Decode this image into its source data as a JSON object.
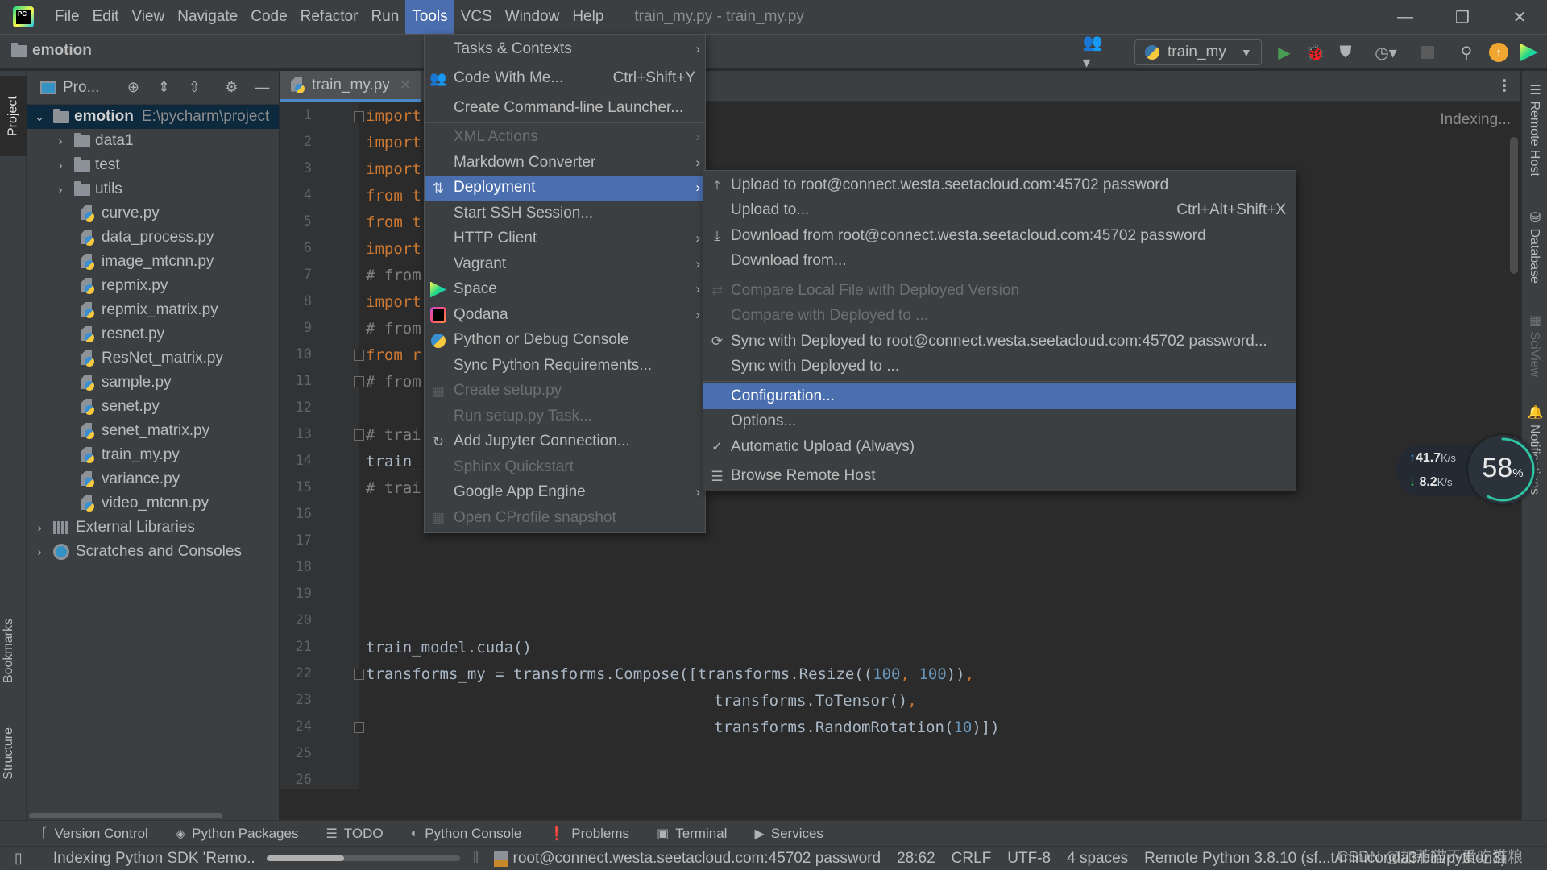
{
  "titlebar": {
    "menus": [
      "File",
      "Edit",
      "View",
      "Navigate",
      "Code",
      "Refactor",
      "Run",
      "Tools",
      "VCS",
      "Window",
      "Help"
    ],
    "active_menu": "Tools",
    "window_title": "train_my.py - train_my.py",
    "controls": {
      "minimize": "—",
      "restore": "❐",
      "close": "✕"
    }
  },
  "navbar": {
    "breadcrumb": "emotion",
    "run_config": "train_my",
    "icons": [
      "code-with-me-icon",
      "run-icon",
      "debug-icon",
      "coverage-icon",
      "profile-icon",
      "stop-icon",
      "search-icon",
      "update-icon",
      "space-icon"
    ]
  },
  "left_stripe": {
    "project": "Project",
    "bookmarks": "Bookmarks",
    "structure": "Structure"
  },
  "project_panel": {
    "title": "Pro...",
    "root": {
      "name": "emotion",
      "path": "E:\\pycharm\\project"
    },
    "folders": [
      "data1",
      "test",
      "utils"
    ],
    "files": [
      "curve.py",
      "data_process.py",
      "image_mtcnn.py",
      "repmix.py",
      "repmix_matrix.py",
      "resnet.py",
      "ResNet_matrix.py",
      "sample.py",
      "senet.py",
      "senet_matrix.py",
      "train_my.py",
      "variance.py",
      "video_mtcnn.py"
    ],
    "extras": [
      "External Libraries",
      "Scratches and Consoles"
    ]
  },
  "editor": {
    "tab": "train_my.py",
    "indexing_hint": "Indexing...",
    "line_numbers": [
      "1",
      "2",
      "3",
      "4",
      "5",
      "6",
      "7",
      "8",
      "9",
      "10",
      "11",
      "12",
      "13",
      "14",
      "15",
      "16",
      "17",
      "18",
      "19",
      "20",
      "21",
      "22",
      "23",
      "24",
      "25",
      "26"
    ],
    "visible_fragments": {
      "l1": "import",
      "l2": "import",
      "l3": "import",
      "l4": "from t",
      "l5": "from t",
      "l6": "import",
      "l7": "# from",
      "l8": "import",
      "l9": "# from",
      "l10": "from r",
      "l11": "# from",
      "l13": "# trai",
      "l14": "train_",
      "l15": "# trai"
    },
    "code": {
      "l21": "train_model.cuda()",
      "l22_a": "transforms_my = transforms.Compose([transforms.Resize((",
      "l22_n1": "100",
      "l22_c": ", ",
      "l22_n2": "100",
      "l22_b": "))",
      "l22_comma": ",",
      "l23": "transforms.ToTensor()",
      "l23_comma": ",",
      "l24_a": "transforms.RandomRotation(",
      "l24_n": "10",
      "l24_b": ")])"
    }
  },
  "tools_menu": {
    "items": [
      {
        "label": "Tasks & Contexts",
        "submenu": true
      },
      {
        "label": "Code With Me...",
        "shortcut": "Ctrl+Shift+Y",
        "icon": "code-with-me-icon"
      },
      {
        "label": "Create Command-line Launcher..."
      },
      {
        "label": "XML Actions",
        "submenu": true,
        "disabled": true
      },
      {
        "label": "Markdown Converter",
        "submenu": true
      },
      {
        "label": "Deployment",
        "submenu": true,
        "highlighted": true,
        "icon": "deployment-icon"
      },
      {
        "label": "Start SSH Session..."
      },
      {
        "label": "HTTP Client",
        "submenu": true
      },
      {
        "label": "Vagrant",
        "submenu": true
      },
      {
        "label": "Space",
        "submenu": true,
        "icon": "space-icon"
      },
      {
        "label": "Qodana",
        "submenu": true,
        "icon": "qodana-icon"
      },
      {
        "label": "Python or Debug Console",
        "icon": "python-console-icon"
      },
      {
        "label": "Sync Python Requirements..."
      },
      {
        "label": "Create setup.py",
        "disabled": true,
        "icon": "setup-py-icon"
      },
      {
        "label": "Run setup.py Task...",
        "disabled": true
      },
      {
        "label": "Add Jupyter Connection...",
        "icon": "jupyter-icon"
      },
      {
        "label": "Sphinx Quickstart",
        "disabled": true
      },
      {
        "label": "Google App Engine",
        "submenu": true
      },
      {
        "label": "Open CProfile snapshot",
        "disabled": true,
        "icon": "cprofile-icon"
      }
    ]
  },
  "deployment_menu": {
    "items": [
      {
        "label": "Upload to root@connect.westa.seetacloud.com:45702 password",
        "icon": "upload-icon"
      },
      {
        "label": "Upload to...",
        "shortcut": "Ctrl+Alt+Shift+X"
      },
      {
        "label": "Download from root@connect.westa.seetacloud.com:45702 password",
        "icon": "download-icon"
      },
      {
        "label": "Download from..."
      },
      {
        "label": "Compare Local File with Deployed Version",
        "disabled": true,
        "icon": "compare-icon"
      },
      {
        "label": "Compare with Deployed to ...",
        "disabled": true
      },
      {
        "label": "Sync with Deployed to root@connect.westa.seetacloud.com:45702 password...",
        "icon": "sync-icon"
      },
      {
        "label": "Sync with Deployed to ..."
      },
      {
        "label": "Configuration...",
        "highlighted": true
      },
      {
        "label": "Options..."
      },
      {
        "label": "Automatic Upload (Always)",
        "checked": true
      },
      {
        "label": "Browse Remote Host",
        "icon": "remote-host-icon"
      }
    ]
  },
  "right_stripe": {
    "remote_host": "Remote Host",
    "database": "Database",
    "sciview": "SciView",
    "notifications": "Notifications"
  },
  "net_widget": {
    "upload": "41.7",
    "download": "8.2",
    "unit": "K/s",
    "percent": 58,
    "percent_sign": "%"
  },
  "tool_tabs": [
    "Version Control",
    "Python Packages",
    "TODO",
    "Python Console",
    "Problems",
    "Terminal",
    "Services"
  ],
  "statusbar": {
    "indexing": "Indexing Python SDK 'Remo..",
    "progress": 0.4,
    "remote": "root@connect.westa.seetacloud.com:45702 password",
    "position": "28:62",
    "line_sep": "CRLF",
    "encoding": "UTF-8",
    "indent": "4 spaces",
    "interpreter": "Remote Python 3.8.10 (sf...t/miniconda3/bin/python3)"
  },
  "watermark": "CSDN @加菲猫不爱吃猫粮"
}
